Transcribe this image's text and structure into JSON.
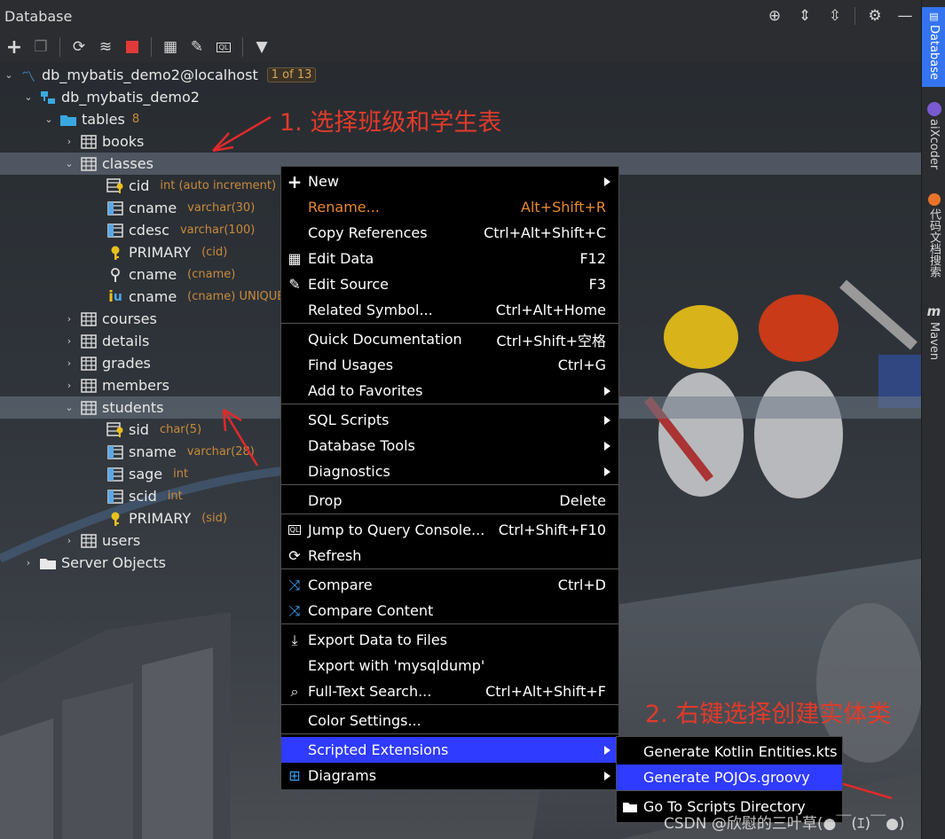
{
  "title": "Database",
  "tree": {
    "root": {
      "label": "db_mybatis_demo2@localhost",
      "badge": "1 of 13"
    },
    "schema": "db_mybatis_demo2",
    "tables_folder": {
      "label": "tables",
      "count": "8"
    },
    "rows": [
      {
        "label": "books",
        "type": ""
      },
      {
        "label": "classes",
        "type": ""
      },
      {
        "label": "cid",
        "type": "int (auto increment)"
      },
      {
        "label": "cname",
        "type": "varchar(30)"
      },
      {
        "label": "cdesc",
        "type": "varchar(100)"
      },
      {
        "label": "PRIMARY",
        "type": "(cid)"
      },
      {
        "label": "cname",
        "type": "(cname)"
      },
      {
        "label": "cname",
        "type": "(cname) UNIQUE"
      },
      {
        "label": "courses",
        "type": ""
      },
      {
        "label": "details",
        "type": ""
      },
      {
        "label": "grades",
        "type": ""
      },
      {
        "label": "members",
        "type": ""
      },
      {
        "label": "students",
        "type": ""
      },
      {
        "label": "sid",
        "type": "char(5)"
      },
      {
        "label": "sname",
        "type": "varchar(28)"
      },
      {
        "label": "sage",
        "type": "int"
      },
      {
        "label": "scid",
        "type": "int"
      },
      {
        "label": "PRIMARY",
        "type": "(sid)"
      },
      {
        "label": "users",
        "type": ""
      }
    ],
    "server_objects": "Server Objects"
  },
  "context_menu": [
    {
      "label": "New",
      "shortcut": "",
      "icon": "plus-icon",
      "submenu": true
    },
    {
      "label": "Rename...",
      "shortcut": "Alt+Shift+R",
      "icon": "",
      "submenu": false
    },
    {
      "label": "Copy References",
      "shortcut": "Ctrl+Alt+Shift+C",
      "icon": "",
      "submenu": false
    },
    {
      "label": "Edit Data",
      "shortcut": "F12",
      "icon": "table-icon",
      "submenu": false
    },
    {
      "label": "Edit Source",
      "shortcut": "F3",
      "icon": "pencil-icon",
      "submenu": false
    },
    {
      "label": "Related Symbol...",
      "shortcut": "Ctrl+Alt+Home",
      "icon": "",
      "submenu": false
    },
    {
      "label": "Quick Documentation",
      "shortcut": "Ctrl+Shift+空格",
      "icon": "",
      "submenu": false
    },
    {
      "label": "Find Usages",
      "shortcut": "Ctrl+G",
      "icon": "",
      "submenu": false
    },
    {
      "label": "Add to Favorites",
      "shortcut": "",
      "icon": "",
      "submenu": true
    },
    {
      "label": "SQL Scripts",
      "shortcut": "",
      "icon": "",
      "submenu": true
    },
    {
      "label": "Database Tools",
      "shortcut": "",
      "icon": "",
      "submenu": true
    },
    {
      "label": "Diagnostics",
      "shortcut": "",
      "icon": "",
      "submenu": true
    },
    {
      "label": "Drop",
      "shortcut": "Delete",
      "icon": "",
      "submenu": false
    },
    {
      "label": "Jump to Query Console...",
      "shortcut": "Ctrl+Shift+F10",
      "icon": "console-icon",
      "submenu": false
    },
    {
      "label": "Refresh",
      "shortcut": "",
      "icon": "refresh-icon",
      "submenu": false
    },
    {
      "label": "Compare",
      "shortcut": "Ctrl+D",
      "icon": "compare-icon",
      "submenu": false
    },
    {
      "label": "Compare Content",
      "shortcut": "",
      "icon": "compare-icon",
      "submenu": false
    },
    {
      "label": "Export Data to Files",
      "shortcut": "",
      "icon": "download-icon",
      "submenu": false
    },
    {
      "label": "Export with 'mysqldump'",
      "shortcut": "",
      "icon": "",
      "submenu": false
    },
    {
      "label": "Full-Text Search...",
      "shortcut": "Ctrl+Alt+Shift+F",
      "icon": "search-icon",
      "submenu": false
    },
    {
      "label": "Color Settings...",
      "shortcut": "",
      "icon": "",
      "submenu": false
    },
    {
      "label": "Scripted Extensions",
      "shortcut": "",
      "icon": "",
      "submenu": true
    },
    {
      "label": "Diagrams",
      "shortcut": "",
      "icon": "diagram-icon",
      "submenu": true
    }
  ],
  "submenu": [
    {
      "label": "Generate Kotlin Entities.kts"
    },
    {
      "label": "Generate POJOs.groovy"
    },
    {
      "label": "Go To Scripts Directory"
    }
  ],
  "right_tabs": [
    "Database",
    "aiXcoder",
    "代码文档搜索",
    "Maven"
  ],
  "annotations": {
    "step1": "1. 选择班级和学生表",
    "step2": "2. 右键选择创建实体类"
  },
  "watermark": "CSDN @欣慰的三叶草(●￣(ｴ)￣●)",
  "colors": {
    "menu_highlight": "#2f3bff",
    "accent": "#3574f0",
    "type_text": "#c98a3a",
    "annotation": "#e23a2a"
  }
}
